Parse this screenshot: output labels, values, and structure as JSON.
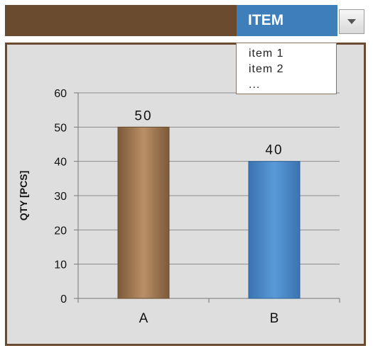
{
  "selector": {
    "header_label": "ITEM",
    "options": [
      "item 1",
      "item 2",
      "..."
    ]
  },
  "colors": {
    "topbar": "#6b4b30",
    "header": "#3f7fb9",
    "bar_a": "#a9815a",
    "bar_b": "#4f8fd0",
    "panel_bg": "#dedede"
  },
  "icons": {
    "dropdown": "chevron-down-icon"
  },
  "chart_data": {
    "type": "bar",
    "categories": [
      "A",
      "B"
    ],
    "values": [
      50,
      40
    ],
    "data_labels": [
      "50",
      "40"
    ],
    "ylabel": "QTY [PCS]",
    "ylim": [
      0,
      60
    ],
    "yticks": [
      "0",
      "10",
      "20",
      "30",
      "40",
      "50",
      "60"
    ],
    "grid": true
  }
}
